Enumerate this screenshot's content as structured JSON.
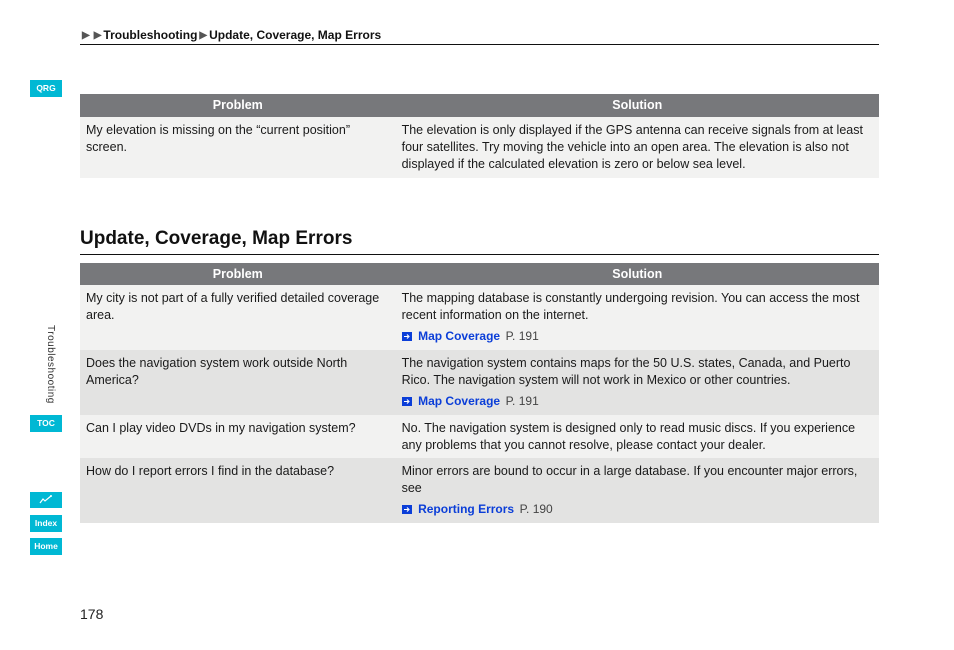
{
  "breadcrumb": {
    "a": "Troubleshooting",
    "b": "Update, Coverage, Map Errors"
  },
  "table1": {
    "header_problem": "Problem",
    "header_solution": "Solution",
    "rows": [
      {
        "problem": "My elevation is missing on the “current position” screen.",
        "solution": "The elevation is only displayed if the GPS antenna can receive signals from at least four satellites. Try moving the vehicle into an open area. The elevation is also not displayed if the calculated elevation is zero or below sea level."
      }
    ]
  },
  "section_heading": "Update, Coverage, Map Errors",
  "table2": {
    "header_problem": "Problem",
    "header_solution": "Solution",
    "rows": [
      {
        "problem": "My city is not part of a fully verified detailed coverage area.",
        "solution": "The mapping database is constantly undergoing revision. You can access the most recent information on the internet.",
        "xref_label": "Map Coverage",
        "xref_page": "P. 191"
      },
      {
        "problem": "Does the navigation system work outside North America?",
        "solution": "The navigation system contains maps for the 50 U.S. states, Canada, and Puerto Rico. The navigation system will not work in Mexico or other countries.",
        "xref_label": "Map Coverage",
        "xref_page": "P. 191"
      },
      {
        "problem": "Can I play video DVDs in my navigation system?",
        "solution": "No. The navigation system is designed only to read music discs. If you experience any problems that you cannot resolve, please contact your dealer."
      },
      {
        "problem": "How do I report errors I find in the database?",
        "solution": "Minor errors are bound to occur in a large database. If you encounter major errors, see",
        "xref_label": "Reporting Errors",
        "xref_page": "P. 190"
      }
    ]
  },
  "sidebar": {
    "qrg": "QRG",
    "toc": "TOC",
    "index": "Index",
    "home": "Home",
    "section_tab": "Troubleshooting"
  },
  "page_number": "178"
}
